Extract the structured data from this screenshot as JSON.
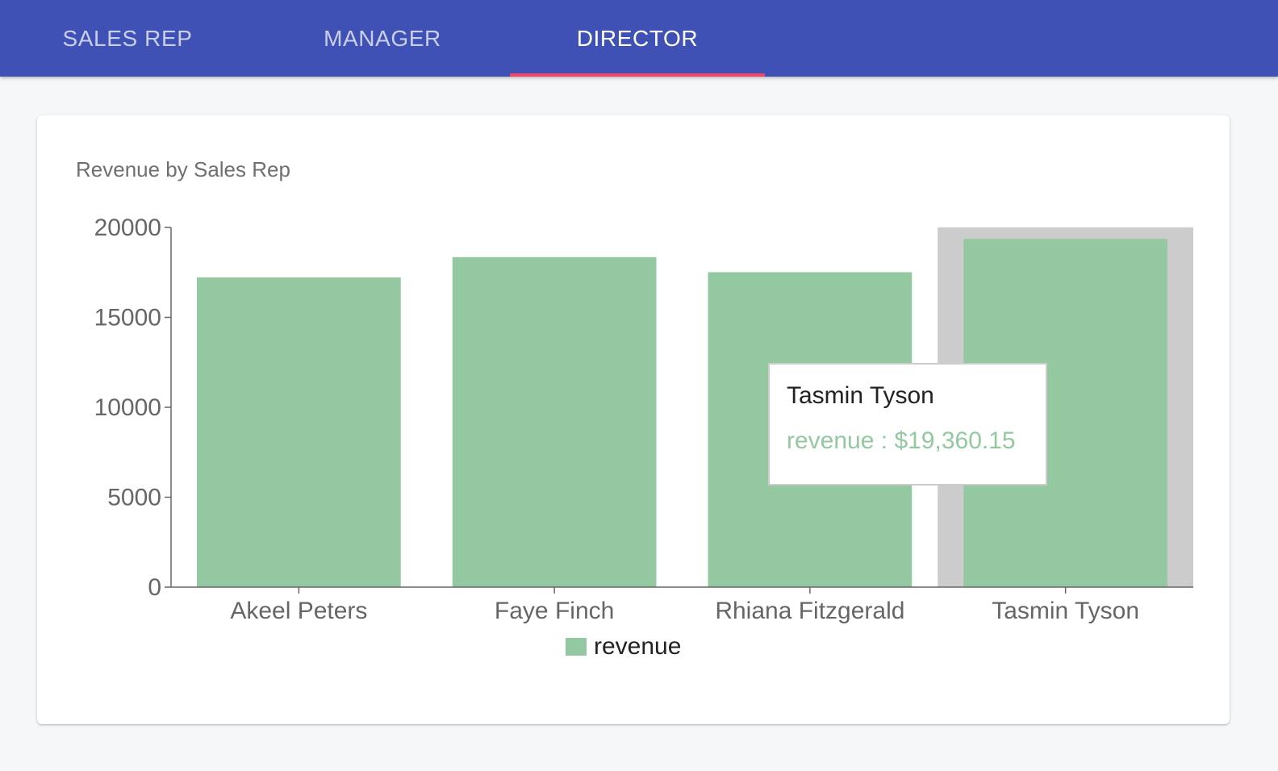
{
  "tabs": [
    {
      "label": "SALES REP",
      "active": false
    },
    {
      "label": "MANAGER",
      "active": false
    },
    {
      "label": "DIRECTOR",
      "active": true
    }
  ],
  "colors": {
    "appbar": "#3f51b5",
    "tab_indicator": "#f44366",
    "bar": "#93c8a0",
    "hover_highlight": "#cccccc"
  },
  "card": {
    "title": "Revenue by Sales Rep"
  },
  "chart_data": {
    "type": "bar",
    "title": "Revenue by Sales Rep",
    "categories": [
      "Akeel Peters",
      "Faye Finch",
      "Rhiana Fitzgerald",
      "Tasmin Tyson"
    ],
    "series": [
      {
        "name": "revenue",
        "values": [
          17220,
          18350,
          17510,
          19360.15
        ],
        "color": "#93c8a0"
      }
    ],
    "yticks": [
      0,
      5000,
      10000,
      15000,
      20000
    ],
    "ylim": [
      0,
      20000
    ],
    "xlabel": "",
    "ylabel": "",
    "grid": false,
    "legend": {
      "placement": "bottom-center",
      "entries": [
        "revenue"
      ]
    },
    "highlighted_category": "Tasmin Tyson"
  },
  "tooltip": {
    "title": "Tasmin Tyson",
    "series_name": "revenue",
    "separator": " : ",
    "value": "$19,360.15"
  }
}
